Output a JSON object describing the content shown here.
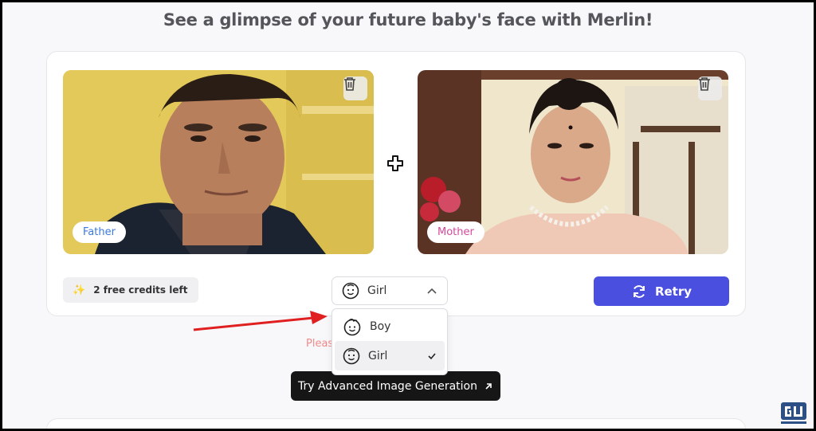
{
  "headline": "See a glimpse of your future baby's face with Merlin!",
  "parents": {
    "father_label": "Father",
    "mother_label": "Mother"
  },
  "credits": {
    "text": "2 free credits left",
    "icon": "sparkle-icon"
  },
  "gender_select": {
    "selected": "Girl",
    "options": [
      {
        "label": "Boy",
        "icon": "boy-face-icon",
        "selected": false
      },
      {
        "label": "Girl",
        "icon": "girl-face-icon",
        "selected": true
      }
    ]
  },
  "retry": {
    "label": "Retry",
    "icon": "refresh-icon"
  },
  "hint": "Pleas                              he baby",
  "advanced_button": {
    "label": "Try Advanced Image Generation",
    "icon": "external-arrow-icon"
  },
  "colors": {
    "accent": "#4a4fe0",
    "father_tag": "#3b7ae0",
    "mother_tag": "#d6489b",
    "annotation_arrow": "#e02020"
  }
}
